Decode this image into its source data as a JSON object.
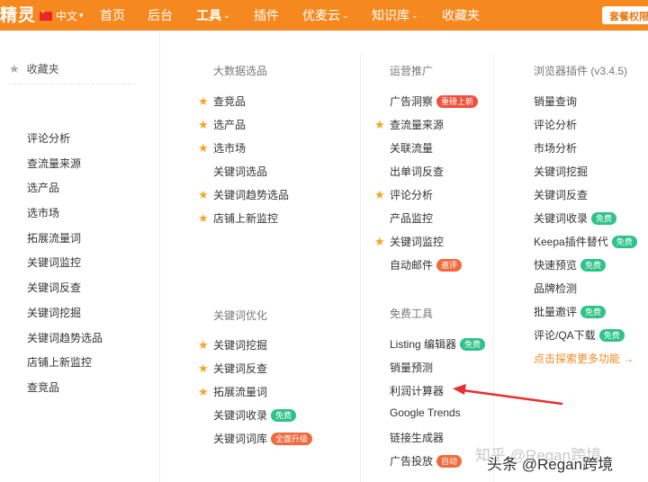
{
  "topbar": {
    "logo": "精灵",
    "lang": "中文",
    "nav": [
      {
        "label": "首页",
        "caret": false,
        "active": false
      },
      {
        "label": "后台",
        "caret": false,
        "active": false
      },
      {
        "label": "工具",
        "caret": true,
        "active": true
      },
      {
        "label": "插件",
        "caret": false,
        "active": false
      },
      {
        "label": "优麦云",
        "caret": true,
        "active": false
      },
      {
        "label": "知识库",
        "caret": true,
        "active": false
      },
      {
        "label": "收藏夹",
        "caret": false,
        "active": false
      }
    ],
    "plan_button": "套餐权限"
  },
  "sidebar": {
    "title": "收藏夹",
    "items": [
      "评论分析",
      "查流量来源",
      "选产品",
      "选市场",
      "拓展流量词",
      "关键词监控",
      "关键词反查",
      "关键词挖掘",
      "关键词趋势选品",
      "店铺上新监控",
      "查竞品"
    ]
  },
  "col1": {
    "sec1": {
      "title": "大数据选品",
      "items": [
        {
          "label": "查竞品",
          "star": true
        },
        {
          "label": "选产品",
          "star": true
        },
        {
          "label": "选市场",
          "star": true
        },
        {
          "label": "关键词选品",
          "star": false
        },
        {
          "label": "关键词趋势选品",
          "star": true
        },
        {
          "label": "店铺上新监控",
          "star": true
        }
      ]
    },
    "sec2": {
      "title": "关键词优化",
      "items": [
        {
          "label": "关键词挖掘",
          "star": true
        },
        {
          "label": "关键词反查",
          "star": true
        },
        {
          "label": "拓展流量词",
          "star": true
        },
        {
          "label": "关键词收录",
          "star": false,
          "badge": "免费",
          "badge_color": "green"
        },
        {
          "label": "关键词词库",
          "star": false,
          "badge": "全面升级",
          "badge_color": "orange"
        }
      ]
    }
  },
  "col2": {
    "sec1": {
      "title": "运营推广",
      "items": [
        {
          "label": "广告洞察",
          "star": false,
          "badge": "重磅上新",
          "badge_color": "red"
        },
        {
          "label": "查流量来源",
          "star": true
        },
        {
          "label": "关联流量",
          "star": false
        },
        {
          "label": "出单词反查",
          "star": false
        },
        {
          "label": "评论分析",
          "star": true
        },
        {
          "label": "产品监控",
          "star": false
        },
        {
          "label": "关键词监控",
          "star": true
        },
        {
          "label": "自动邮件",
          "star": false,
          "badge": "邀评",
          "badge_color": "orange"
        }
      ]
    },
    "sec2": {
      "title": "免费工具",
      "items": [
        {
          "label": "Listing 编辑器",
          "star": false,
          "badge": "免费",
          "badge_color": "green"
        },
        {
          "label": "销量预测",
          "star": false
        },
        {
          "label": "利润计算器",
          "star": false
        },
        {
          "label": "Google Trends",
          "star": false
        },
        {
          "label": "链接生成器",
          "star": false
        },
        {
          "label": "广告投放",
          "star": false,
          "badge": "自动",
          "badge_color": "orange"
        }
      ]
    }
  },
  "col3": {
    "title": "浏览器插件",
    "version": "(v3.4.5)",
    "items": [
      {
        "label": "销量查询"
      },
      {
        "label": "评论分析"
      },
      {
        "label": "市场分析"
      },
      {
        "label": "关键词挖掘"
      },
      {
        "label": "关键词反查"
      },
      {
        "label": "关键词收录",
        "badge": "免费",
        "badge_color": "green"
      },
      {
        "label": "Keepa插件替代",
        "badge": "免费",
        "badge_color": "green"
      },
      {
        "label": "快速预览",
        "badge": "免费",
        "badge_color": "green"
      },
      {
        "label": "品牌检测"
      },
      {
        "label": "批量邀评",
        "badge": "免费",
        "badge_color": "green"
      },
      {
        "label": "评论/QA下载",
        "badge": "免费",
        "badge_color": "green"
      }
    ],
    "more_link": "点击探索更多功能 →"
  },
  "watermark": {
    "back": "知乎 @Regan跨境",
    "front": "头条 @Regan跨境"
  },
  "colors": {
    "topbar": "#f5891f",
    "star": "#f4a521",
    "badge_green": "#2fc289",
    "badge_orange": "#f26a3b",
    "badge_red": "#f0503c",
    "arrow": "#e8302e"
  }
}
